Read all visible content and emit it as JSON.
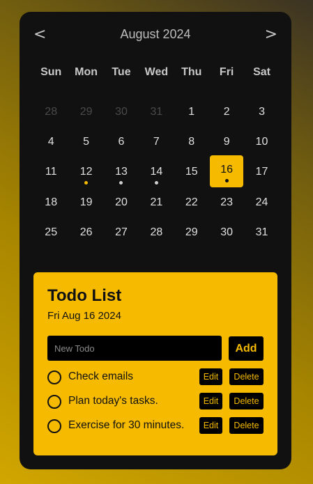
{
  "calendar": {
    "prev_label": "<",
    "next_label": ">",
    "month_title": "August 2024",
    "weekdays": [
      "Sun",
      "Mon",
      "Tue",
      "Wed",
      "Thu",
      "Fri",
      "Sat"
    ],
    "days": [
      {
        "label": "28",
        "muted": true
      },
      {
        "label": "29",
        "muted": true
      },
      {
        "label": "30",
        "muted": true
      },
      {
        "label": "31",
        "muted": true
      },
      {
        "label": "1"
      },
      {
        "label": "2"
      },
      {
        "label": "3"
      },
      {
        "label": "4"
      },
      {
        "label": "5"
      },
      {
        "label": "6"
      },
      {
        "label": "7"
      },
      {
        "label": "8"
      },
      {
        "label": "9"
      },
      {
        "label": "10"
      },
      {
        "label": "11"
      },
      {
        "label": "12",
        "dot": "#f6bb00"
      },
      {
        "label": "13",
        "dot": "#d0d0d0"
      },
      {
        "label": "14",
        "dot": "#d0d0d0"
      },
      {
        "label": "15"
      },
      {
        "label": "16",
        "selected": true,
        "dot": "#111111"
      },
      {
        "label": "17"
      },
      {
        "label": "18"
      },
      {
        "label": "19"
      },
      {
        "label": "20"
      },
      {
        "label": "21"
      },
      {
        "label": "22"
      },
      {
        "label": "23"
      },
      {
        "label": "24"
      },
      {
        "label": "25"
      },
      {
        "label": "26"
      },
      {
        "label": "27"
      },
      {
        "label": "28"
      },
      {
        "label": "29"
      },
      {
        "label": "30"
      },
      {
        "label": "31"
      }
    ]
  },
  "todo": {
    "title": "Todo List",
    "date": "Fri Aug 16 2024",
    "input_placeholder": "New Todo",
    "input_value": "",
    "add_label": "Add",
    "items": [
      {
        "text": "Check emails",
        "edit_label": "Edit",
        "delete_label": "Delete"
      },
      {
        "text": "Plan today's tasks.",
        "edit_label": "Edit",
        "delete_label": "Delete"
      },
      {
        "text": "Exercise for 30 minutes.",
        "edit_label": "Edit",
        "delete_label": "Delete"
      }
    ]
  },
  "colors": {
    "accent": "#f6bb00",
    "card_bg": "#111111",
    "muted_day": "#4a4a4a"
  }
}
